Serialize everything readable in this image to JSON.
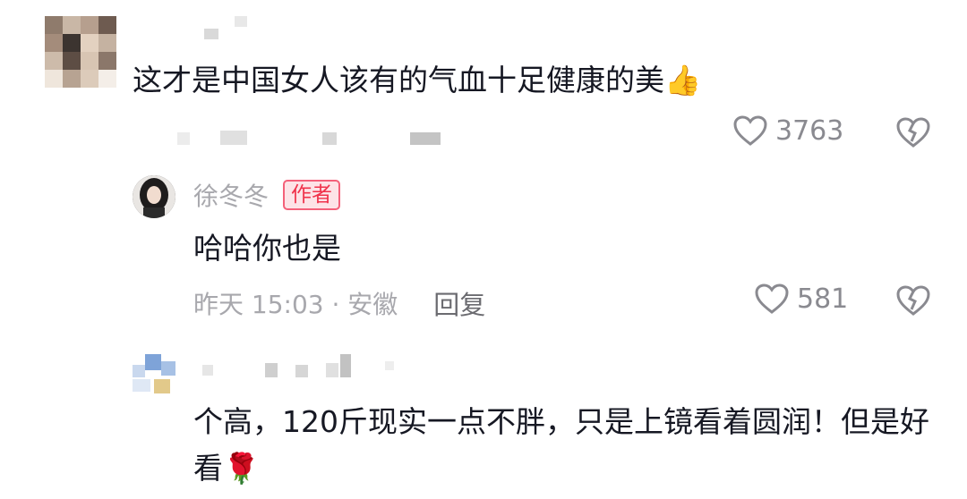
{
  "comment1": {
    "text": "这才是中国女人该有的气血十足健康的美",
    "emoji": "👍",
    "likes": "3763"
  },
  "reply1": {
    "username": "徐冬冬",
    "badge": "作者",
    "text": "哈哈你也是",
    "time_location": "昨天 15:03 · 安徽",
    "reply_label": "回复",
    "likes": "581"
  },
  "comment2": {
    "text": "个高，120斤现实一点不胖，只是上镜看着圆润！但是好看",
    "emoji": "🌹"
  },
  "icons": {
    "like": "heart-outline-icon",
    "dislike": "broken-heart-icon"
  },
  "colors": {
    "badge_text": "#f0324b",
    "badge_bg": "#fde3e7",
    "meta_gray": "#a8a8ad"
  }
}
